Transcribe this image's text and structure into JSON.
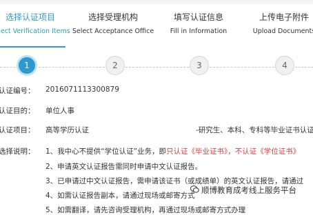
{
  "steps": [
    {
      "zh": "选择认证项目",
      "en": "Select Verification Items",
      "num": "1"
    },
    {
      "zh": "选择受理机构",
      "en": "Select Acceptance Office",
      "num": "2"
    },
    {
      "zh": "填写认证信息",
      "en": "Fill in Information",
      "num": "3"
    },
    {
      "zh": "上传电子附件",
      "en": "Upload Documents",
      "num": "4"
    }
  ],
  "fields": {
    "number_label": "认证编号：",
    "number_value": "2016071113300879",
    "purpose_label": "认证目的：",
    "purpose_value": "单位人事",
    "item_label": "认证项目：",
    "item_value": "高等学历认证",
    "item_note": "-研究生、本科、专科等毕业证书认证",
    "desc_label": "选择说明："
  },
  "notes": {
    "n1_prefix": "1、我中心不提供“学位认证”业务，即",
    "n1_red": "只认证《毕业证书》，不认证《学位证书》",
    "n2": "2、申请英文认证报告需同时申请中文认证报告。",
    "n3": "3、已申请过中文认证报告，需申请该证书（或成绩单）的英文认证报告，请通过",
    "n4": "4、如需认证报告副本，请通过现场或邮寄方式",
    "n5": "5、如需翻译，请先咨询受理机构，再通过现场或邮寄方式办理"
  },
  "watermark": "顺博教育成考线上服务平台",
  "colors": {
    "accent": "#2c9ad1",
    "red": "#e23b3b"
  }
}
